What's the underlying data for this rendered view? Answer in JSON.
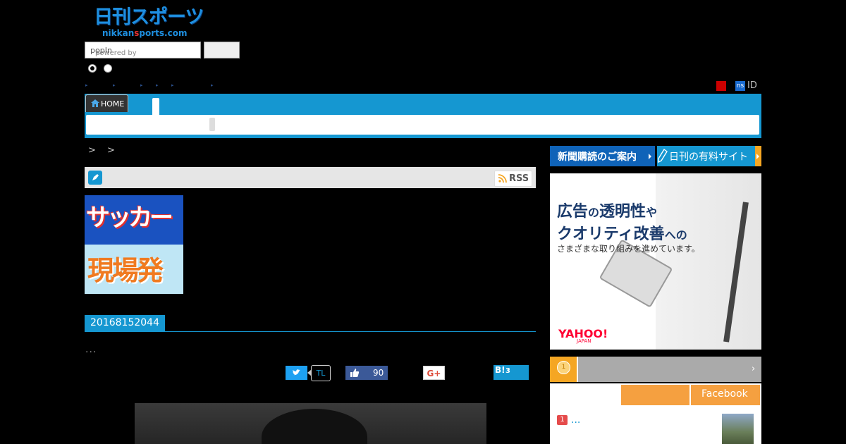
{
  "logo": {
    "main": "日刊スポーツ",
    "sub_pre": "nikkan",
    "sub_mid": "s",
    "sub_post": "ports.com"
  },
  "search": {
    "placeholder_prefix": "powered by",
    "provider": "popIn",
    "button_label": ""
  },
  "header": {
    "ns_badge": "ns",
    "id_label": "ID"
  },
  "nav": {
    "home_label": "HOME"
  },
  "breadcrumb": {
    "text": "> >"
  },
  "section": {
    "rss_label": "RSS"
  },
  "banner": {
    "top": "サッカー",
    "bottom": "現場発"
  },
  "article": {
    "date": "20168152044",
    "lead": "..."
  },
  "share": {
    "tl_label": "TL",
    "fb_count": "90",
    "gplus_label": "G+",
    "hatena_label": "B!",
    "hatena_count": "3"
  },
  "sidebar": {
    "subscribe_label": "新聞購読のご案内",
    "paid_label": "日刊の有料サイト",
    "ad": {
      "line1_a": "広告",
      "line1_b": "の",
      "line1_c": "透明性",
      "line1_d": "や",
      "line2_a": "クオリティ改善",
      "line2_b": "への",
      "line3": "さまざまな取り組みを進めています。",
      "brand": "YAHOO!",
      "brand_sub": "JAPAN"
    },
    "ranking": {
      "medal": "1",
      "chevron": "›",
      "tab_facebook": "Facebook",
      "items": [
        {
          "rank": "1",
          "title": "..."
        }
      ]
    }
  },
  "colors": {
    "accent": "#1597d1",
    "nav_dark": "#0f63b8",
    "orange": "#f5a040",
    "background": "#000000"
  }
}
